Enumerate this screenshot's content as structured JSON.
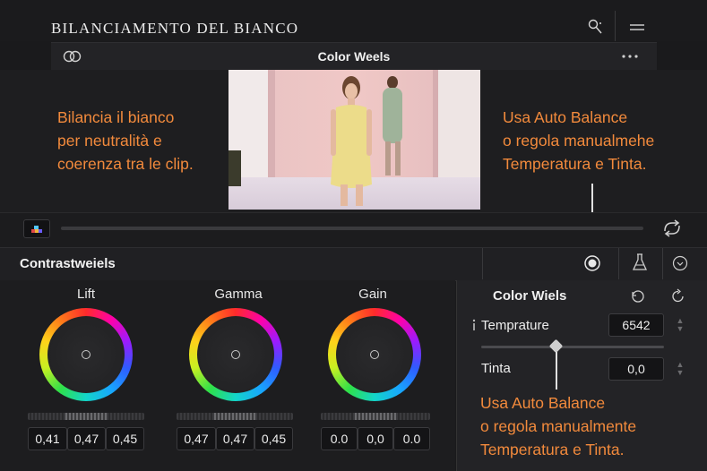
{
  "header": {
    "title": "BILANCIAMENTO DEL BIANCO"
  },
  "panel": {
    "title": "Color Weels"
  },
  "notes": {
    "left": [
      "Bilancia il bianco",
      "per neutralità e",
      "coerenza tra le clip."
    ],
    "right_top": [
      "Usa Auto Balance",
      "o regola manualmehe",
      "Temperatura e Tinta."
    ],
    "right_bottom": [
      "Usa Auto Balance",
      "o regola manualmente",
      "Temperatura e Tinta."
    ]
  },
  "section": {
    "title": "Contrastweiels"
  },
  "wheels": [
    {
      "label": "Lift",
      "values": [
        "0,41",
        "0,47",
        "0,45"
      ]
    },
    {
      "label": "Gamma",
      "values": [
        "0,47",
        "0,47",
        "0,45"
      ]
    },
    {
      "label": "Gain",
      "values": [
        "0.0",
        "0,0",
        "0.0"
      ]
    }
  ],
  "color_panel": {
    "title": "Color Wiels",
    "temperature_label": "Temprature",
    "temperature_value": "6542",
    "tint_label": "Tinta",
    "tint_value": "0,0"
  },
  "colors": {
    "accent": "#f28a3c",
    "background": "#1a1a1c"
  }
}
